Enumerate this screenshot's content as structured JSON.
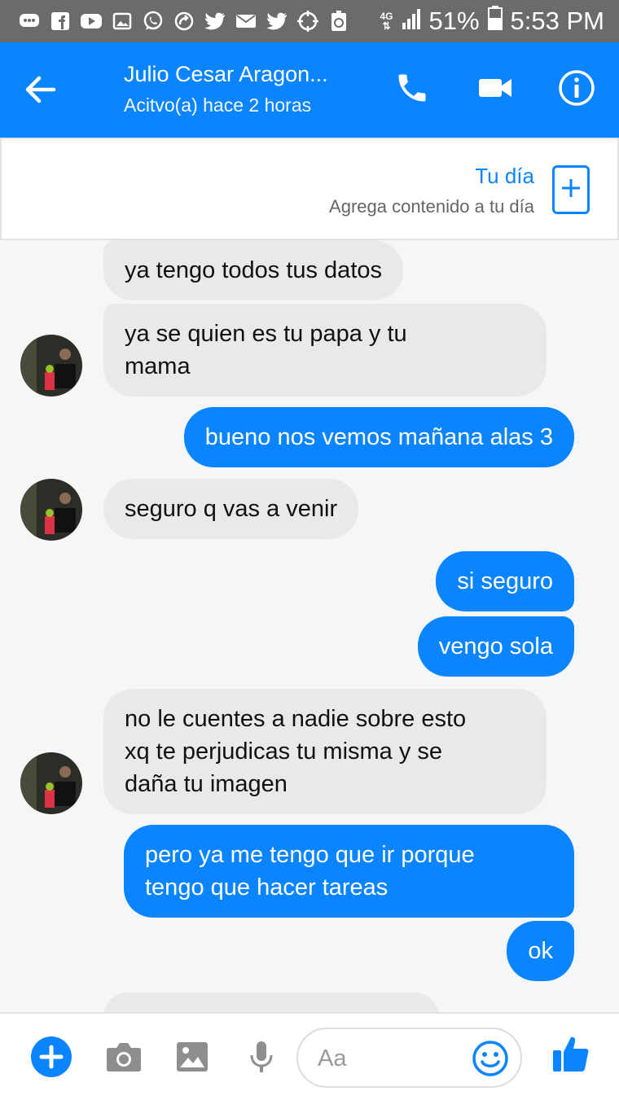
{
  "status_bar": {
    "network": "4G",
    "battery": "51%",
    "time": "5:53 PM",
    "icons": [
      "message-icon",
      "facebook-icon",
      "youtube-icon",
      "gallery-icon",
      "whatsapp-icon",
      "sync-icon",
      "twitter-icon",
      "mail-icon",
      "twitter-icon",
      "location-icon",
      "recycle-icon"
    ]
  },
  "header": {
    "title": "Julio Cesar Aragon...",
    "subtitle": "Acitvo(a) hace 2 horas"
  },
  "tu_dia": {
    "title": "Tu día",
    "subtitle": "Agrega contenido a tu día"
  },
  "messages": [
    {
      "dir": "in",
      "text": "ya tengo todos tus datos"
    },
    {
      "dir": "in",
      "text": "ya se quien es tu papa y tu\nmama",
      "avatar": true
    },
    {
      "dir": "out",
      "text": "bueno nos vemos mañana alas 3"
    },
    {
      "dir": "in",
      "text": "seguro q vas a venir",
      "avatar": true
    },
    {
      "dir": "out",
      "text": "si seguro"
    },
    {
      "dir": "out",
      "text": "vengo sola"
    },
    {
      "dir": "in",
      "text": "no le cuentes a nadie sobre esto\nxq te perjudicas tu misma y se\ndaña tu imagen",
      "avatar": true
    },
    {
      "dir": "out",
      "text": "pero ya me tengo que ir porque\ntengo que hacer tareas"
    },
    {
      "dir": "out",
      "text": "ok"
    }
  ],
  "composer": {
    "placeholder": "Aa"
  },
  "colors": {
    "accent": "#0a84ff",
    "incoming_bubble": "#e9e9eb",
    "status_bar": "#6b6b6b"
  }
}
